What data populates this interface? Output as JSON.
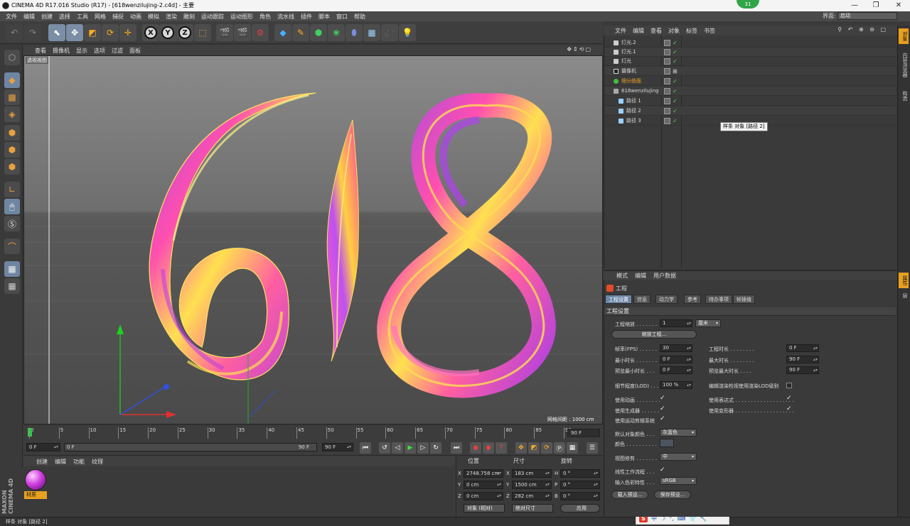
{
  "window": {
    "title": "CINEMA 4D R17.016 Studio (R17) - [618wenzilujing-2.c4d] - 主要",
    "badge": "31",
    "minimize": "—",
    "restore": "❐",
    "close": "✕"
  },
  "menubar": {
    "items": [
      "文件",
      "编辑",
      "创建",
      "选择",
      "工具",
      "网格",
      "捕捉",
      "动画",
      "模拟",
      "渲染",
      "雕刻",
      "运动跟踪",
      "运动图形",
      "角色",
      "流水线",
      "插件",
      "脚本",
      "窗口",
      "帮助"
    ],
    "layout_label": "界面:",
    "layout_value": "启动"
  },
  "toolbar": {
    "x": "X",
    "y": "Y",
    "z": "Z"
  },
  "viewport": {
    "menu": [
      "查看",
      "摄像机",
      "显示",
      "选项",
      "过滤",
      "面板"
    ],
    "label": "透视视图",
    "grid_label": "网格间距 : 1000 cm",
    "nav": "✥⇕⟲▢"
  },
  "timeline": {
    "ticks": [
      "0",
      "5",
      "10",
      "15",
      "20",
      "25",
      "30",
      "35",
      "40",
      "45",
      "50",
      "55",
      "60",
      "65",
      "70",
      "75",
      "80",
      "85",
      "90"
    ],
    "current_frame": "90 F",
    "start": "0 F",
    "range_start": "0 F",
    "range_end": "90 F",
    "end": "90 F"
  },
  "materials": {
    "menu": [
      "创建",
      "编辑",
      "功能",
      "纹理"
    ],
    "items": [
      {
        "name": "材质"
      }
    ],
    "logo": "MAXON CINEMA 4D"
  },
  "coords": {
    "headers": {
      "position": "位置",
      "size": "尺寸",
      "rotation": "旋转"
    },
    "rows": [
      {
        "axis": "X",
        "pos": "2748.758 cm",
        "size_axis": "X",
        "size": "183 cm",
        "rot_axis": "H",
        "rot": "0 °"
      },
      {
        "axis": "Y",
        "pos": "0 cm",
        "size_axis": "Y",
        "size": "1500 cm",
        "rot_axis": "P",
        "rot": "0 °"
      },
      {
        "axis": "Z",
        "pos": "0 cm",
        "size_axis": "Z",
        "size": "282 cm",
        "rot_axis": "B",
        "rot": "0 °"
      }
    ],
    "mode": "对象 (相对)",
    "size_mode": "绝对尺寸",
    "apply": "应用"
  },
  "objects": {
    "menu": [
      "文件",
      "编辑",
      "查看",
      "对象",
      "标签",
      "书签"
    ],
    "items": [
      {
        "name": "灯光.2"
      },
      {
        "name": "灯光.1"
      },
      {
        "name": "灯光"
      },
      {
        "name": "摄像机"
      },
      {
        "name": "细分曲面"
      },
      {
        "name": "618wenzilujing"
      },
      {
        "name": "路径 1"
      },
      {
        "name": "路径 2"
      },
      {
        "name": "路径 3"
      }
    ],
    "tooltip": "样条 对象 [路径 2]"
  },
  "attributes": {
    "menu": [
      "模式",
      "编辑",
      "用户数据"
    ],
    "title": "工程",
    "tabs": [
      "工程设置",
      "信息",
      "动力学",
      "参考",
      "待办事项",
      "帧插值"
    ],
    "section": "工程设置",
    "scale_label": "工程缩放 . . . . . . .",
    "scale_value": "1",
    "scale_unit": "厘米",
    "scale_button": "缩放工程...",
    "fps_label": "帧率(FPS) . . . . . .",
    "fps": "30",
    "min_label": "最小时长 . . . . . . .",
    "min": "0 F",
    "pmin_label": "预览最小时长 . . .",
    "pmin": "0 F",
    "dur_label": "工程时长 . . . . . . . .",
    "dur": "0 F",
    "max_label": "最大时长 . . . . . . . .",
    "max": "90 F",
    "pmax_label": "预览最大时长 . . . .",
    "pmax": "90 F",
    "lod_label": "细节程度(LOD) . . .",
    "lod": "100 %",
    "lod_render_label": "编辑渲染检视使用渲染LOD级别",
    "anim_label": "使用动画 . . . . . . . .",
    "expr_label": "使用表达式 . . . . . . . . . . . . . . . . . . .",
    "gen_label": "使用生成器 . . . . . .",
    "deform_label": "使用变形器 . . . . . . . . . . . . . . . . . . .",
    "motion_label": "使用运动剪辑系统",
    "color_label": "默认对象颜色 . . .",
    "color_value": "灰蓝色",
    "colorfield_label": "颜色 . . . . . . . . . .",
    "clip_label": "视图修剪 . . . . . . .",
    "clip_value": "中",
    "linear_label": "线性工作流程 . . .",
    "profile_label": "输入色彩特性 . . .",
    "profile_value": "sRGB",
    "load_preset": "载入预设...",
    "save_preset": "保存预设...",
    "check": "✓"
  },
  "rightstrip": {
    "tabs_top": [
      "对象",
      "内容浏览器",
      "构造"
    ],
    "tabs_bottom": [
      "属性",
      "层"
    ]
  },
  "statusbar": {
    "text": "样条 对象 [路径 2]"
  },
  "ime": {
    "s": "S",
    "zh": "中"
  },
  "colors": {
    "accent": "#6d86a6",
    "material": "#e8a020",
    "ribbon_pink": "#ff4fb0",
    "ribbon_purple": "#a44ce0",
    "ribbon_yellow": "#ffe050"
  }
}
